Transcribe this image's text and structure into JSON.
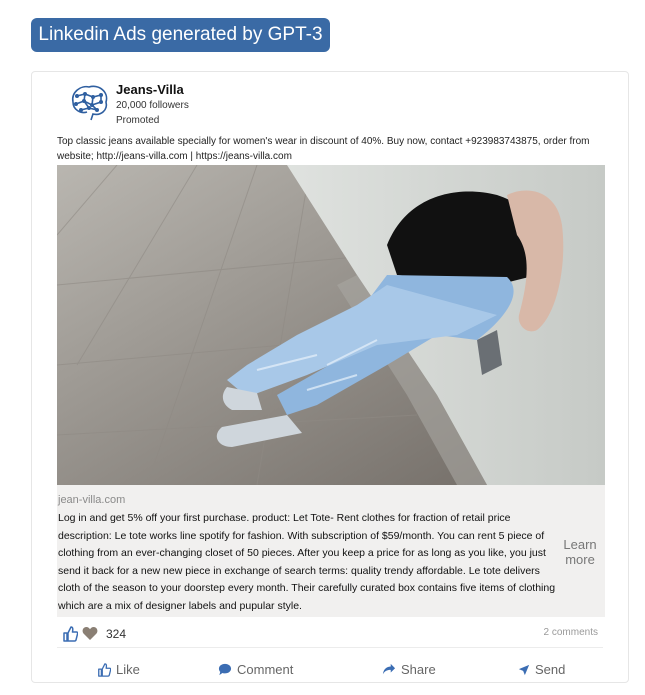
{
  "page": {
    "heading": "Linkedin Ads generated by GPT-3"
  },
  "post": {
    "company": "Jeans-Villa",
    "followers": "20,000 followers",
    "promoted": "Promoted",
    "text": "Top classic jeans available specially for women's wear in discount of 40%. Buy now, contact +923983743875, order from website; http://jeans-villa.com | https://jeans-villa.com",
    "image_icon": "photo-woman-in-jeans-sitting-against-wall"
  },
  "ad": {
    "domain": "jean-villa.com",
    "description": "Log in and get 5% off your first purchase. product: Let Tote- Rent clothes for fraction of retail price description: Le tote works line spotify for fashion. With subscription of $59/month. You can rent 5 piece of clothing from an ever-changing closet of 50 pieces. After you keep a price for as long as you like, you just send it back for a new new piece in exchange of search terms: quality trendy affordable. Le tote delivers cloth of the season to your doorstep every month. Their carefully curated box contains five items of clothing which are a mix of designer labels and pupular style.",
    "cta": "Learn more"
  },
  "social": {
    "reactions_count": "324",
    "comments": "2 comments"
  },
  "actions": {
    "like": "Like",
    "comment": "Comment",
    "share": "Share",
    "send": "Send"
  },
  "colors": {
    "heading_bg": "#3a6aa5",
    "like_blue": "#3b6db3",
    "logo_blue": "#2f5fa0",
    "ad_bg": "#f1f0ef"
  }
}
